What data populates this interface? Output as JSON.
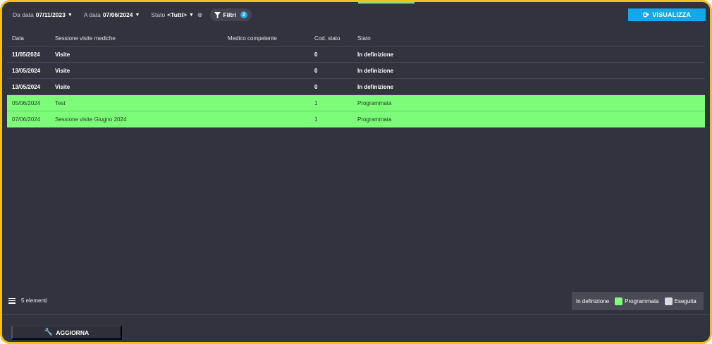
{
  "filters": {
    "from": {
      "label": "Da data",
      "value": "07/11/2023"
    },
    "to": {
      "label": "A data",
      "value": "07/06/2024"
    },
    "status": {
      "label": "Stato",
      "value": "<Tutti>"
    },
    "filtri": {
      "label": "Filtri",
      "count": "2"
    }
  },
  "toolbar": {
    "visualizza_label": "VISUALIZZA"
  },
  "table": {
    "headers": [
      "Data",
      "Sessione visite mediche",
      "Medico competente",
      "Cod. stato",
      "Stato"
    ],
    "rows": [
      {
        "date": "11/05/2024",
        "session": "Visite",
        "doctor": "",
        "code": "0",
        "status": "In definizione"
      },
      {
        "date": "13/05/2024",
        "session": "Visite",
        "doctor": "",
        "code": "0",
        "status": "In definizione"
      },
      {
        "date": "13/05/2024",
        "session": "Visite",
        "doctor": "",
        "code": "0",
        "status": "In definizione"
      },
      {
        "date": "05/06/2024",
        "session": "Test",
        "doctor": "",
        "code": "1",
        "status": "Programmata"
      },
      {
        "date": "07/06/2024",
        "session": "Sessione visite Giugno 2024",
        "doctor": "",
        "code": "1",
        "status": "Programmata"
      }
    ]
  },
  "footer": {
    "count_label": "5 elementi"
  },
  "legend": {
    "items": [
      {
        "label": "In definizione",
        "color": ""
      },
      {
        "label": "Programmata",
        "color": "#7dfc7a"
      },
      {
        "label": "Eseguita",
        "color": "#d9d9dd"
      }
    ]
  },
  "actions": {
    "aggiorna_label": "AGGIORNA"
  },
  "colors": {
    "accent": "#13a8ea",
    "frame": "#f2c21b",
    "background": "#33333f",
    "programmata": "#7dfc7a"
  }
}
